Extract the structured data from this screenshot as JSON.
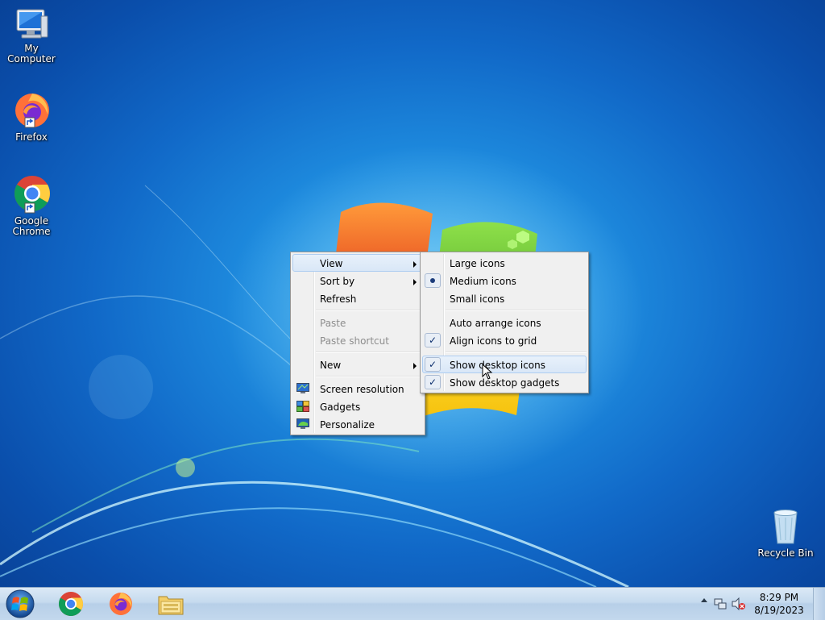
{
  "desktop": {
    "icons": [
      {
        "label": "My Computer"
      },
      {
        "label": "Firefox"
      },
      {
        "label": "Google Chrome"
      },
      {
        "label": "Recycle Bin"
      }
    ]
  },
  "context_menu": {
    "items": [
      {
        "label": "View",
        "submenu": true,
        "hover": true
      },
      {
        "label": "Sort by",
        "submenu": true
      },
      {
        "label": "Refresh"
      },
      {
        "label": "Paste",
        "disabled": true
      },
      {
        "label": "Paste shortcut",
        "disabled": true
      },
      {
        "label": "New",
        "submenu": true
      },
      {
        "label": "Screen resolution",
        "icon": "screen-resolution-icon"
      },
      {
        "label": "Gadgets",
        "icon": "gadgets-icon"
      },
      {
        "label": "Personalize",
        "icon": "personalize-icon"
      }
    ]
  },
  "view_submenu": {
    "items": [
      {
        "label": "Large icons"
      },
      {
        "label": "Medium icons",
        "selected": true
      },
      {
        "label": "Small icons"
      },
      {
        "label": "Auto arrange icons",
        "checked": false
      },
      {
        "label": "Align icons to grid",
        "checked": true
      },
      {
        "label": "Show desktop icons",
        "checked": true,
        "hover": true
      },
      {
        "label": "Show desktop gadgets",
        "checked": true
      }
    ],
    "check_glyph": "✓"
  },
  "taskbar": {
    "apps": [
      {
        "name": "chrome-taskbar-icon"
      },
      {
        "name": "firefox-taskbar-icon"
      },
      {
        "name": "file-explorer-taskbar-icon"
      }
    ],
    "clock": {
      "time": "8:29 PM",
      "date": "8/19/2023"
    }
  },
  "colors": {
    "desktop_blue": "#1169c8",
    "menu_bg": "#f0f0f0",
    "menu_hover": "#d9e7f7",
    "taskbar": "#c5daee"
  }
}
